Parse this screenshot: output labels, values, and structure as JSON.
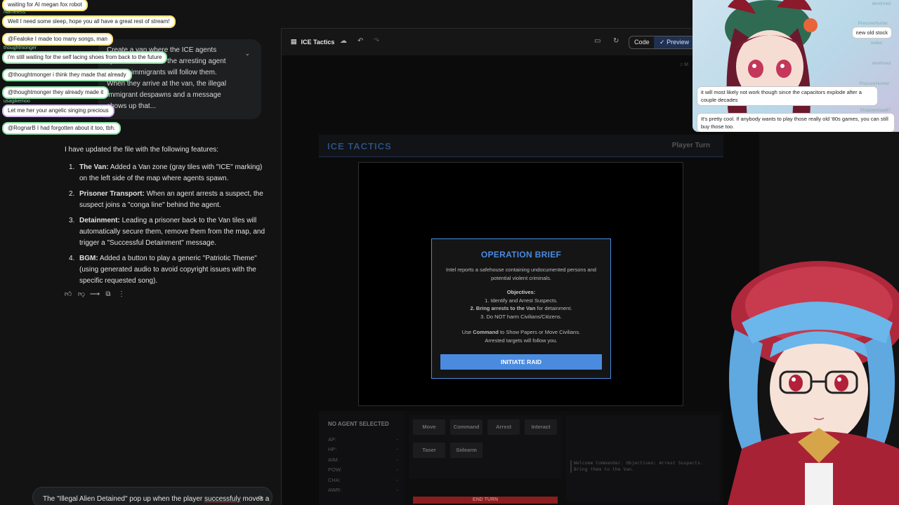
{
  "stream_chat": [
    {
      "name": "",
      "text": "waiting for AI megan fox robot"
    },
    {
      "name": "Nameless",
      "text": "Well I need some sleep, hope you all have a great rest of stream!"
    },
    {
      "name": "",
      "text": "@Fealoke I made too many songs, man"
    },
    {
      "name": "thoughtmonger",
      "text": "i'm still waiting for the self lacing shoes from back to the future"
    },
    {
      "name": "",
      "text": "@thoughtmonger i think they made that already"
    },
    {
      "name": "",
      "text": "@thoughtmonger they already made it"
    },
    {
      "name": "usagikemoo",
      "text": "Let me her your angelic singing precious"
    },
    {
      "name": "",
      "text": "@RognarB I had forgotten about it too, tbh."
    }
  ],
  "user_prompt": {
    "text": "Create a van where the ICE agents spawn front. When the arresting agent moves, immigrants will follow them. When they arrive at the van, the illegal immigrant despawns and a message shows up that..."
  },
  "response": {
    "intro": "I have updated the file with the following features:",
    "features": [
      {
        "num": "1.",
        "title": "The Van:",
        "text": " Added a Van zone (gray tiles with \"ICE\" marking) on the left side of the map where agents spawn."
      },
      {
        "num": "2.",
        "title": "Prisoner Transport:",
        "text": " When an agent arrests a suspect, the suspect joins a \"conga line\" behind the agent."
      },
      {
        "num": "3.",
        "title": "Detainment:",
        "text": " Leading a prisoner back to the Van tiles will automatically secure them, remove them from the map, and trigger a \"Successful Detainment\" message."
      },
      {
        "num": "4.",
        "title": "BGM:",
        "text": " Added a button to play a generic \"Patriotic Theme\" (using generated audio to avoid copyright issues with the specific requested song)."
      }
    ]
  },
  "chat_input": {
    "before": "The \"Illegal Alien Detained\" pop up when the player ",
    "underlined": "successfuly",
    "after": " moves a"
  },
  "preview": {
    "app_title": "ICE Tactics",
    "code_label": "Code",
    "preview_label": "Preview",
    "mini_label": "M"
  },
  "game": {
    "title": "ICE TACTICS",
    "turn": "Player Turn",
    "brief": {
      "title": "OPERATION BRIEF",
      "intro": "Intel reports a safehouse containing undocumented persons and potential violent criminals.",
      "objectives_heading": "Objectives:",
      "obj1": "1. Identify and Arrest Suspects.",
      "obj2_bold": "2. Bring arrests to the Van",
      "obj2_rest": " for detainment.",
      "obj3": "3. Do NOT harm Civilians/Citizens.",
      "cmd_pre": "Use ",
      "cmd_bold": "Command",
      "cmd_post": " to Show Papers or Move Civilians.",
      "cmd_line2": "Arrested targets will follow you.",
      "button": "INITIATE RAID"
    },
    "hud": {
      "agent_heading": "NO AGENT SELECTED",
      "stats": [
        {
          "label": "AP:",
          "value": "-"
        },
        {
          "label": "HP:",
          "value": "-"
        },
        {
          "label": "AIM:",
          "value": "-"
        },
        {
          "label": "POW:",
          "value": "-"
        },
        {
          "label": "CHA:",
          "value": "-"
        },
        {
          "label": "AWR:",
          "value": "-"
        }
      ],
      "actions": [
        "Move",
        "Command",
        "Arrest",
        "Interact",
        "Taser",
        "Sidearm"
      ],
      "end_turn": "END TURN",
      "log": "Welcome Commander. Objectives: Arrest Suspects. Bring them to the Van."
    }
  },
  "cam_chat": [
    {
      "name": "devilnred",
      "text": ""
    },
    {
      "name": "PrecureHunter",
      "text": "new old stock"
    },
    {
      "name": "redex",
      "text": ""
    },
    {
      "name": "devilnred",
      "text": ""
    },
    {
      "name": "PrecureHunter",
      "text": "it will most likely not work though since the capacitors explode after a couple decades"
    },
    {
      "name": "Shadowclaw87",
      "text": "It's pretty cool. If anybody wants to play those really old '80s games, you can still buy those too."
    }
  ],
  "colors": {
    "accent_blue": "#4a8be0",
    "end_turn_red": "#8b1d1d",
    "page_bg": "#131314"
  }
}
